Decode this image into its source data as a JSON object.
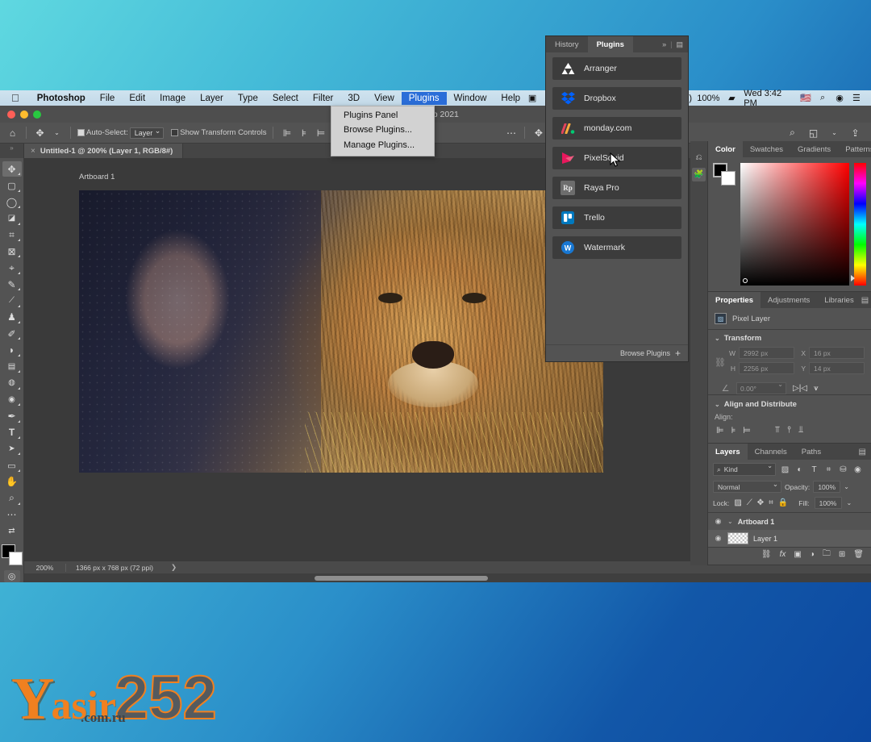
{
  "desktop": {
    "watermark": {
      "y": "Y",
      "word": "asir",
      "domain": ".com.ru",
      "number": "252"
    }
  },
  "menubar": {
    "apple_icon": "apple-icon",
    "items": [
      {
        "label": "Photoshop",
        "bold": true,
        "active": false
      },
      {
        "label": "File",
        "bold": false,
        "active": false
      },
      {
        "label": "Edit",
        "bold": false,
        "active": false
      },
      {
        "label": "Image",
        "bold": false,
        "active": false
      },
      {
        "label": "Layer",
        "bold": false,
        "active": false
      },
      {
        "label": "Type",
        "bold": false,
        "active": false
      },
      {
        "label": "Select",
        "bold": false,
        "active": false
      },
      {
        "label": "Filter",
        "bold": false,
        "active": false
      },
      {
        "label": "3D",
        "bold": false,
        "active": false
      },
      {
        "label": "View",
        "bold": false,
        "active": false
      },
      {
        "label": "Plugins",
        "bold": false,
        "active": true
      },
      {
        "label": "Window",
        "bold": false,
        "active": false
      },
      {
        "label": "Help",
        "bold": false,
        "active": false
      }
    ],
    "status": {
      "battery_percent": "100%",
      "clock": "Wed 3:42 PM",
      "flag": "US",
      "icons": [
        "screen-recorder-icon",
        "dropbox-icon",
        "cloud-sync-icon",
        "onedrive-icon",
        "video-icon",
        "circle-icon",
        "airplay-icon",
        "bluetooth-icon",
        "wifi-icon",
        "volume-icon",
        "battery-icon",
        "keyboard-flag-icon",
        "search-icon",
        "siri-icon",
        "control-center-icon"
      ]
    }
  },
  "plugins_menu": {
    "items": [
      "Plugins Panel",
      "Browse Plugins...",
      "Manage Plugins..."
    ]
  },
  "window": {
    "title": "toshop 2021",
    "traffic_lights": [
      "close",
      "minimize",
      "zoom"
    ]
  },
  "options_bar": {
    "home_icon": "home-icon",
    "tool_icon": "move-tool-icon",
    "auto_select_label": "Auto-Select:",
    "auto_select_checked": true,
    "auto_select_value": "Layer",
    "show_transform_label": "Show Transform Controls",
    "show_transform_checked": false,
    "align_icons": [
      "align-left-icon",
      "align-center-h-icon",
      "align-right-icon",
      "distribute-h-icon",
      "align-top-icon",
      "align-middle-v-icon",
      "align-bottom-icon"
    ],
    "extra_icons": [
      "more-icon",
      "3d-move-icon",
      "3d-rotate-icon",
      "3d-camera-icon"
    ],
    "right_icons": [
      "search-icon",
      "workspace-icon",
      "chevron-down-icon",
      "share-icon"
    ]
  },
  "document_tab": {
    "close_glyph": "×",
    "title": "Untitled-1 @ 200% (Layer 1, RGB/8#)"
  },
  "toolbar": {
    "tools": [
      {
        "name": "move-tool",
        "glyph": "✥",
        "selected": true
      },
      {
        "name": "marquee-tool",
        "glyph": "▭",
        "selected": false
      },
      {
        "name": "lasso-tool",
        "glyph": "◯",
        "selected": false
      },
      {
        "name": "quick-selection-tool",
        "glyph": "◤",
        "selected": false
      },
      {
        "name": "crop-tool",
        "glyph": "⌗",
        "selected": false
      },
      {
        "name": "frame-tool",
        "glyph": "⊠",
        "selected": false
      },
      {
        "name": "eyedropper-tool",
        "glyph": "⌖",
        "selected": false
      },
      {
        "name": "healing-brush-tool",
        "glyph": "✎",
        "selected": false
      },
      {
        "name": "brush-tool",
        "glyph": "🖌",
        "selected": false
      },
      {
        "name": "clone-stamp-tool",
        "glyph": "⚑",
        "selected": false
      },
      {
        "name": "history-brush-tool",
        "glyph": "✐",
        "selected": false
      },
      {
        "name": "eraser-tool",
        "glyph": "◧",
        "selected": false
      },
      {
        "name": "gradient-tool",
        "glyph": "▤",
        "selected": false
      },
      {
        "name": "blur-tool",
        "glyph": "💧",
        "selected": false
      },
      {
        "name": "dodge-tool",
        "glyph": "🔍",
        "selected": false
      },
      {
        "name": "pen-tool",
        "glyph": "✒",
        "selected": false
      },
      {
        "name": "type-tool",
        "glyph": "T",
        "selected": false
      },
      {
        "name": "path-selection-tool",
        "glyph": "➤",
        "selected": false
      },
      {
        "name": "rectangle-tool",
        "glyph": "▢",
        "selected": false
      },
      {
        "name": "hand-tool",
        "glyph": "✋",
        "selected": false
      },
      {
        "name": "zoom-tool",
        "glyph": "🔎",
        "selected": false
      },
      {
        "name": "edit-toolbar",
        "glyph": "⋯",
        "selected": false
      },
      {
        "name": "swap-colors",
        "glyph": "⇄",
        "selected": false
      }
    ],
    "foreground_color": "#000000",
    "background_color": "#ffffff",
    "quick_mask_icon": "quick-mask-icon"
  },
  "canvas": {
    "artboard_label": "Artboard 1",
    "zoom": "200%",
    "dimensions": "1366 px x 768 px (72 ppi)",
    "status_arrow": "❯"
  },
  "plugins_panel": {
    "tabs": [
      {
        "label": "History",
        "active": false
      },
      {
        "label": "Plugins",
        "active": true
      }
    ],
    "collapse_glyph": "»",
    "menu_glyph": "▤",
    "items": [
      {
        "label": "Arranger",
        "icon": "arranger-icon"
      },
      {
        "label": "Dropbox",
        "icon": "dropbox-icon"
      },
      {
        "label": "monday.com",
        "icon": "monday-icon"
      },
      {
        "label": "PixelSquid",
        "icon": "pixelsquid-icon"
      },
      {
        "label": "Raya Pro",
        "icon": "raya-pro-icon"
      },
      {
        "label": "Trello",
        "icon": "trello-icon"
      },
      {
        "label": "Watermark",
        "icon": "watermark-icon"
      }
    ],
    "footer": {
      "label": "Browse Plugins",
      "plus": "+"
    }
  },
  "icon_dock": {
    "icons": [
      "history-icon",
      "plugins-icon"
    ]
  },
  "color_panel": {
    "tabs": [
      {
        "label": "Color",
        "active": true
      },
      {
        "label": "Swatches",
        "active": false
      },
      {
        "label": "Gradients",
        "active": false
      },
      {
        "label": "Patterns",
        "active": false
      }
    ],
    "foreground": "#000000",
    "background": "#ffffff",
    "menu_glyph": "▤"
  },
  "properties_panel": {
    "tabs": [
      {
        "label": "Properties",
        "active": true
      },
      {
        "label": "Adjustments",
        "active": false
      },
      {
        "label": "Libraries",
        "active": false
      }
    ],
    "menu_glyph": "▤",
    "layer_type": "Pixel Layer",
    "layer_icon": "pixel-layer-icon",
    "transform": {
      "title": "Transform",
      "w_label": "W",
      "w_value": "2992 px",
      "x_label": "X",
      "x_value": "16 px",
      "h_label": "H",
      "h_value": "2256 px",
      "y_label": "Y",
      "y_value": "14 px",
      "angle_icon": "angle-icon",
      "angle_value": "0.00°",
      "flip_h_icon": "flip-horizontal-icon",
      "flip_v_icon": "flip-vertical-icon",
      "link_icon": "link-icon"
    },
    "align": {
      "title": "Align and Distribute",
      "label": "Align:",
      "icons": [
        "align-left-icon",
        "align-center-h-icon",
        "align-right-icon",
        "align-top-icon",
        "align-middle-v-icon",
        "align-bottom-icon"
      ]
    }
  },
  "layers_panel": {
    "tabs": [
      {
        "label": "Layers",
        "active": true
      },
      {
        "label": "Channels",
        "active": false
      },
      {
        "label": "Paths",
        "active": false
      }
    ],
    "menu_glyph": "▤",
    "filter": {
      "kind_label": "Kind",
      "search_icon": "search-icon",
      "icons": [
        "pixel-filter-icon",
        "adjustment-filter-icon",
        "type-filter-icon",
        "shape-filter-icon",
        "smart-object-filter-icon"
      ],
      "toggle_icon": "filter-toggle-icon"
    },
    "blend_mode": "Normal",
    "opacity_label": "Opacity:",
    "opacity_value": "100%",
    "lock_label": "Lock:",
    "lock_icons": [
      "lock-transparency-icon",
      "lock-image-icon",
      "lock-position-icon",
      "lock-artboard-icon",
      "lock-all-icon"
    ],
    "fill_label": "Fill:",
    "fill_value": "100%",
    "layers": [
      {
        "name": "Artboard 1",
        "type": "group",
        "visible": true,
        "selected": false
      },
      {
        "name": "Layer 1",
        "type": "pixel",
        "visible": true,
        "selected": true
      }
    ],
    "footer_icons": [
      "link-layers-icon",
      "fx-icon",
      "layer-mask-icon",
      "adjustment-layer-icon",
      "new-group-icon",
      "new-layer-icon",
      "delete-layer-icon"
    ]
  }
}
